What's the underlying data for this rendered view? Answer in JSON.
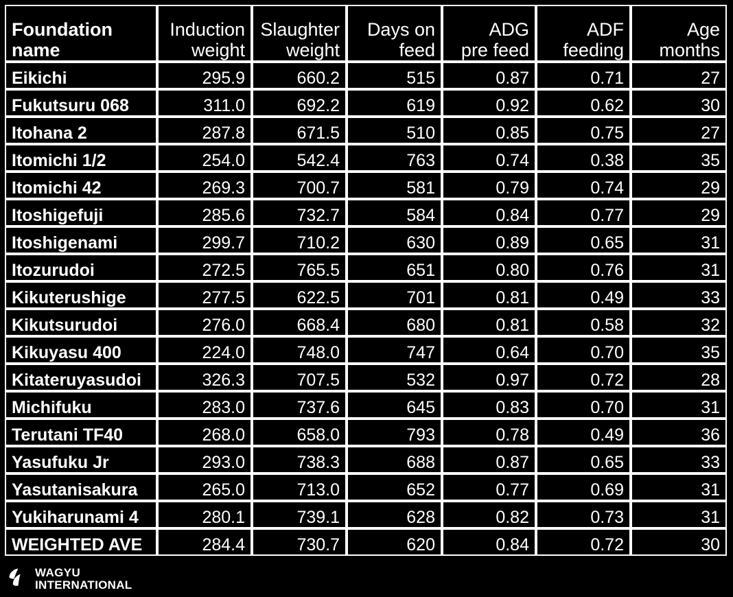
{
  "table": {
    "columns": [
      {
        "key": "name",
        "line1": "Foundation",
        "line2": "name",
        "align": "left"
      },
      {
        "key": "ind",
        "line1": "Induction",
        "line2": "weight",
        "align": "right"
      },
      {
        "key": "sla",
        "line1": "Slaughter",
        "line2": "weight",
        "align": "right"
      },
      {
        "key": "days",
        "line1": "Days on",
        "line2": "feed",
        "align": "right"
      },
      {
        "key": "adg",
        "line1": "ADG",
        "line2": "pre feed",
        "align": "right"
      },
      {
        "key": "adf",
        "line1": "ADF",
        "line2": "feeding",
        "align": "right"
      },
      {
        "key": "age",
        "line1": "Age",
        "line2": "months",
        "align": "right"
      }
    ],
    "rows": [
      {
        "name": "Eikichi",
        "ind": "295.9",
        "sla": "660.2",
        "days": "515",
        "adg": "0.87",
        "adf": "0.71",
        "age": "27"
      },
      {
        "name": "Fukutsuru 068",
        "ind": "311.0",
        "sla": "692.2",
        "days": "619",
        "adg": "0.92",
        "adf": "0.62",
        "age": "30"
      },
      {
        "name": "Itohana 2",
        "ind": "287.8",
        "sla": "671.5",
        "days": "510",
        "adg": "0.85",
        "adf": "0.75",
        "age": "27"
      },
      {
        "name": "Itomichi 1/2",
        "ind": "254.0",
        "sla": "542.4",
        "days": "763",
        "adg": "0.74",
        "adf": "0.38",
        "age": "35"
      },
      {
        "name": "Itomichi 42",
        "ind": "269.3",
        "sla": "700.7",
        "days": "581",
        "adg": "0.79",
        "adf": "0.74",
        "age": "29"
      },
      {
        "name": "Itoshigefuji",
        "ind": "285.6",
        "sla": "732.7",
        "days": "584",
        "adg": "0.84",
        "adf": "0.77",
        "age": "29"
      },
      {
        "name": "Itoshigenami",
        "ind": "299.7",
        "sla": "710.2",
        "days": "630",
        "adg": "0.89",
        "adf": "0.65",
        "age": "31"
      },
      {
        "name": "Itozurudoi",
        "ind": "272.5",
        "sla": "765.5",
        "days": "651",
        "adg": "0.80",
        "adf": "0.76",
        "age": "31"
      },
      {
        "name": "Kikuterushige",
        "ind": "277.5",
        "sla": "622.5",
        "days": "701",
        "adg": "0.81",
        "adf": "0.49",
        "age": "33"
      },
      {
        "name": "Kikutsurudoi",
        "ind": "276.0",
        "sla": "668.4",
        "days": "680",
        "adg": "0.81",
        "adf": "0.58",
        "age": "32"
      },
      {
        "name": "Kikuyasu 400",
        "ind": "224.0",
        "sla": "748.0",
        "days": "747",
        "adg": "0.64",
        "adf": "0.70",
        "age": "35"
      },
      {
        "name": "Kitateruyasudoi",
        "ind": "326.3",
        "sla": "707.5",
        "days": "532",
        "adg": "0.97",
        "adf": "0.72",
        "age": "28"
      },
      {
        "name": "Michifuku",
        "ind": "283.0",
        "sla": "737.6",
        "days": "645",
        "adg": "0.83",
        "adf": "0.70",
        "age": "31"
      },
      {
        "name": "Terutani TF40",
        "ind": "268.0",
        "sla": "658.0",
        "days": "793",
        "adg": "0.78",
        "adf": "0.49",
        "age": "36"
      },
      {
        "name": "Yasufuku Jr",
        "ind": "293.0",
        "sla": "738.3",
        "days": "688",
        "adg": "0.87",
        "adf": "0.65",
        "age": "33"
      },
      {
        "name": "Yasutanisakura",
        "ind": "265.0",
        "sla": "713.0",
        "days": "652",
        "adg": "0.77",
        "adf": "0.69",
        "age": "31"
      },
      {
        "name": "Yukiharunami 4",
        "ind": "280.1",
        "sla": "739.1",
        "days": "628",
        "adg": "0.82",
        "adf": "0.73",
        "age": "31"
      },
      {
        "name": "WEIGHTED AVE",
        "ind": "284.4",
        "sla": "730.7",
        "days": "620",
        "adg": "0.84",
        "adf": "0.72",
        "age": "30"
      }
    ]
  },
  "logo": {
    "icon": "wagyu-leaves-icon",
    "line1": "WAGYU",
    "line2": "INTERNATIONAL"
  },
  "colors": {
    "background": "#000000",
    "text": "#ffffff",
    "border": "#ffffff"
  }
}
